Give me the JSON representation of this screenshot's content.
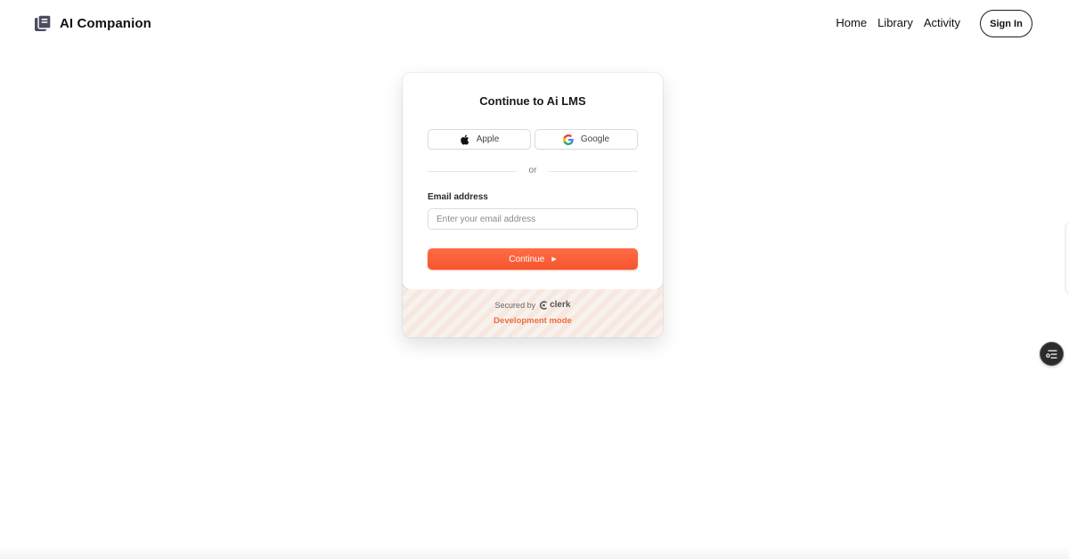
{
  "header": {
    "app_title": "AI Companion",
    "nav": [
      {
        "label": "Home"
      },
      {
        "label": "Library"
      },
      {
        "label": "Activity"
      }
    ],
    "signin_label": "Sign In"
  },
  "auth_card": {
    "title": "Continue to Ai LMS",
    "providers": [
      {
        "label": "Apple",
        "icon": "apple-icon"
      },
      {
        "label": "Google",
        "icon": "google-icon"
      }
    ],
    "divider_text": "or",
    "email_label": "Email address",
    "email_placeholder": "Enter your email address",
    "email_value": "",
    "continue_label": "Continue",
    "secured_by": "Secured by",
    "secured_brand": "clerk",
    "dev_mode": "Development mode"
  },
  "colors": {
    "accent": "#f5552e",
    "dev_mode": "#ef6b3f",
    "text": "#111111"
  },
  "floating_button": {
    "icon": "settings-list-icon"
  }
}
